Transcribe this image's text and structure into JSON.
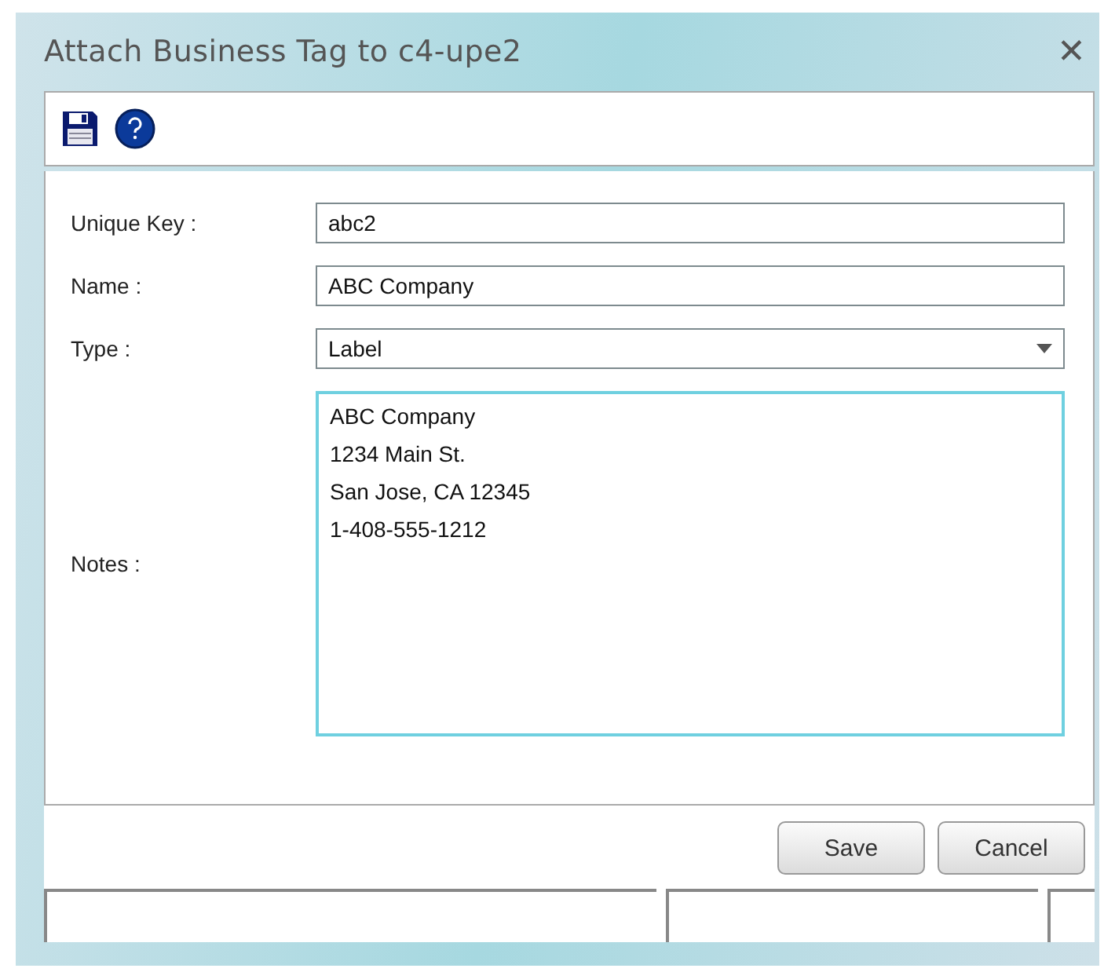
{
  "window": {
    "title": "Attach Business Tag to c4-upe2",
    "close": "✕"
  },
  "fields": [
    {
      "kind": "text",
      "label": "Unique Key :",
      "value": "abc2",
      "focused": false
    },
    {
      "kind": "text",
      "label": "Name :",
      "value": "ABC Company",
      "focused": false
    },
    {
      "kind": "select",
      "label": "Type :",
      "value": "Label",
      "focused": false
    },
    {
      "kind": "textarea",
      "label": "Notes :",
      "value": "ABC Company\n1234 Main St.\nSan Jose, CA 12345\n1-408-555-1212",
      "focused": true
    }
  ],
  "buttons": [
    "Save",
    "Cancel"
  ]
}
